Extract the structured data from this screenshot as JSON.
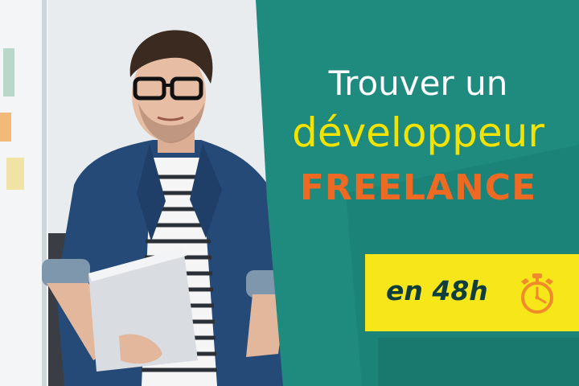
{
  "headline": {
    "line1": "Trouver un",
    "line2": "développeur",
    "line3": "FREELANCE"
  },
  "badge": {
    "text": "en 48h",
    "icon": "stopwatch-icon"
  },
  "colors": {
    "panel": "#1f8a7e",
    "white_text": "#ffffff",
    "yellow_text": "#f2e400",
    "orange_text": "#ee6a22",
    "badge_bg": "#f6e61a",
    "badge_text": "#0f3e3c"
  }
}
